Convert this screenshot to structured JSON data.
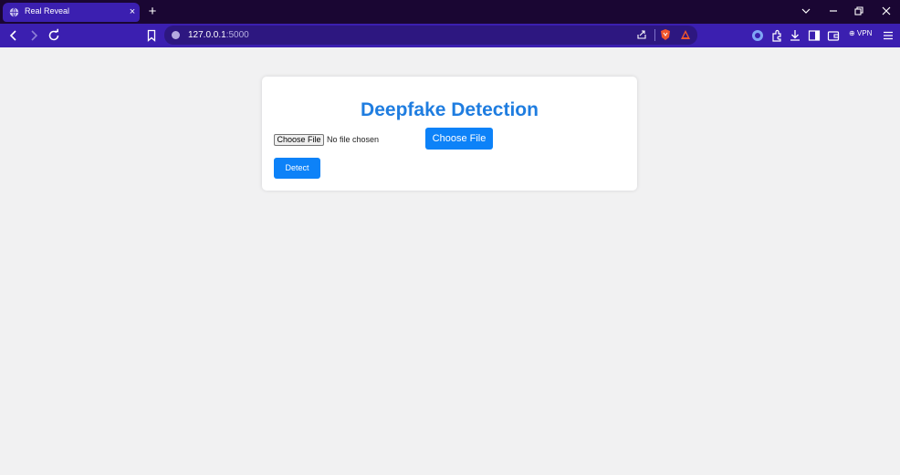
{
  "browser": {
    "tab": {
      "title": "Real Reveal",
      "favicon": "globe-icon",
      "close": "×"
    },
    "new_tab": "+",
    "url": {
      "host": "127.0.0.1",
      "port": ":5000"
    },
    "vpn_label": "⊕ VPN"
  },
  "colors": {
    "title_bar": "#1a0633",
    "toolbar": "#3b1fb0",
    "accent_blue": "#0d82f8",
    "heading_blue": "#1f7de0",
    "page_bg": "#f1f1f2"
  },
  "main": {
    "title": "Deepfake Detection",
    "native_file_button": "Choose File",
    "file_status": "No file chosen",
    "styled_file_button": "Choose File",
    "detect_button": "Detect"
  }
}
